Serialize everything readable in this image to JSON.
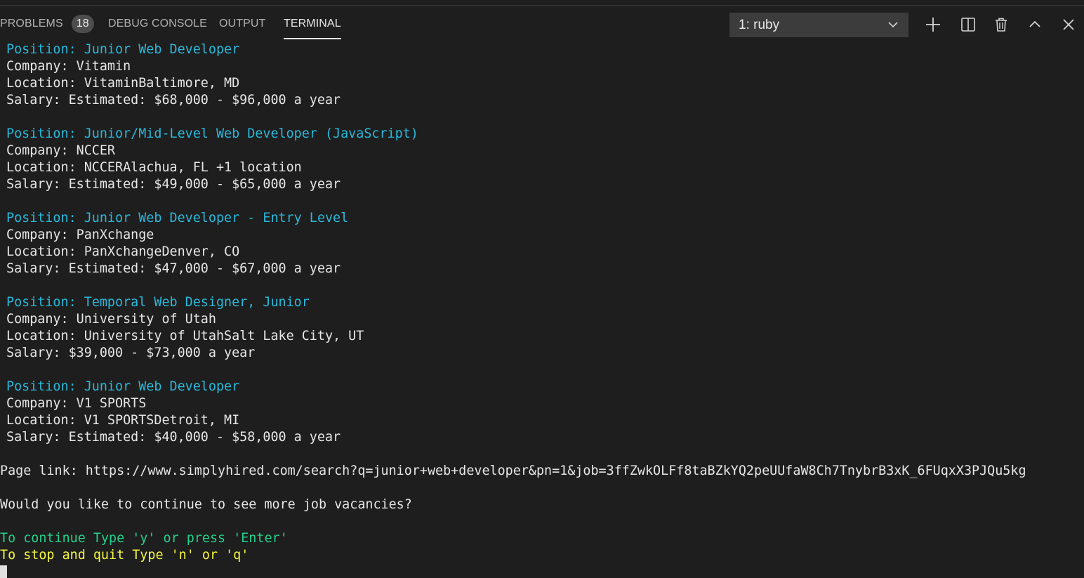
{
  "panel": {
    "tabs": {
      "problems": "PROBLEMS",
      "problems_count": "18",
      "debug_console": "DEBUG CONSOLE",
      "output": "OUTPUT",
      "terminal": "TERMINAL"
    },
    "active_tab": "TERMINAL",
    "terminal_select": "1: ruby",
    "icons": [
      "plus-icon",
      "split-icon",
      "trash-icon",
      "chevron-up-icon",
      "close-icon"
    ]
  },
  "terminal": {
    "jobs": [
      {
        "position": "Position: Junior Web Developer",
        "company": "Company: Vitamin",
        "location": "Location: VitaminBaltimore, MD",
        "salary": "Salary: Estimated: $68,000 - $96,000 a year"
      },
      {
        "position": "Position: Junior/Mid-Level Web Developer (JavaScript)",
        "company": "Company: NCCER",
        "location": "Location: NCCERAlachua, FL +1 location",
        "salary": "Salary: Estimated: $49,000 - $65,000 a year"
      },
      {
        "position": "Position: Junior Web Developer - Entry Level",
        "company": "Company: PanXchange",
        "location": "Location: PanXchangeDenver, CO",
        "salary": "Salary: Estimated: $47,000 - $67,000 a year"
      },
      {
        "position": "Position: Temporal Web Designer, Junior",
        "company": "Company: University of Utah",
        "location": "Location: University of UtahSalt Lake City, UT",
        "salary": "Salary: $39,000 - $73,000 a year"
      },
      {
        "position": "Position: Junior Web Developer",
        "company": "Company: V1 SPORTS",
        "location": "Location: V1 SPORTSDetroit, MI",
        "salary": "Salary: Estimated: $40,000 - $58,000 a year"
      }
    ],
    "page_link": "Page link: https://www.simplyhired.com/search?q=junior+web+developer&pn=1&job=3ffZwkOLFf8taBZkYQ2peUUfaW8Ch7TnybrB3xK_6FUqxX3PJQu5kg",
    "question": "Would you like to continue to see more job vacancies?",
    "continue_hint": "To continue Type 'y' or press 'Enter'",
    "quit_hint": "To stop and quit Type 'n' or 'q'"
  },
  "colors": {
    "background": "#1e1e1e",
    "position_text": "#29b8db",
    "continue_text": "#23d18b",
    "quit_text": "#f5f543",
    "default_text": "#e6e6e6"
  }
}
